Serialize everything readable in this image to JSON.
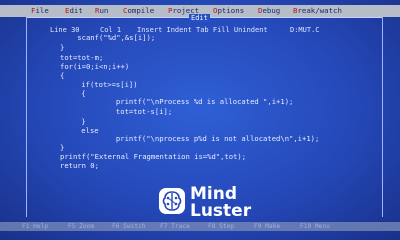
{
  "menu": {
    "items": [
      {
        "hot": "F",
        "rest": "ile"
      },
      {
        "hot": "E",
        "rest": "dit"
      },
      {
        "hot": "R",
        "rest": "un"
      },
      {
        "hot": "C",
        "rest": "ompile"
      },
      {
        "hot": "P",
        "rest": "roject"
      },
      {
        "hot": "O",
        "rest": "ptions"
      },
      {
        "hot": "D",
        "rest": "ebug"
      },
      {
        "hot": "B",
        "rest": "reak/watch"
      }
    ]
  },
  "editor": {
    "title": "Edit",
    "status": {
      "line": "Line 30",
      "col": "Col 1",
      "modes": "Insert Indent Tab Fill Unindent",
      "file": "D:MUT.C"
    },
    "code_lines": [
      "    scanf(\"%d\",&s[i]);",
      "}",
      "tot=tot-m;",
      "for(i=0;i<n;i++)",
      "{",
      "    if(tot>=s[i])",
      "    {",
      "            printf(\"\\nProcess %d is allocated \",i+1);",
      "            tot=tot-s[i];",
      "    }",
      "    else",
      "            printf(\"\\nprocess p%d is not allocated\\n\",i+1);",
      "}",
      "printf(\"External Fragmentation is=%d\",tot);",
      "return 0;"
    ]
  },
  "fkeys": [
    "F1 Help",
    "F5 Zoom",
    "F6 Switch",
    "F7 Trace",
    "F8 Step",
    "F9 Make",
    "F10 Menu"
  ],
  "watermark": {
    "line1": "Mind",
    "line2": "Luster"
  },
  "colors": {
    "background": "#2548b8",
    "menubar": "#b6bdc8",
    "hotkey": "#b21818"
  }
}
